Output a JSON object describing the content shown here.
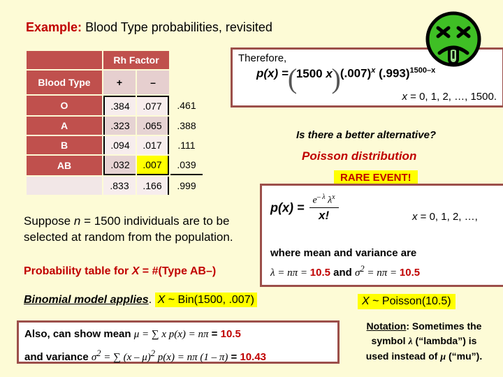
{
  "slide": {
    "background_color": "#fdfbd6",
    "accent_red": "#c00000",
    "table_red": "#c0504d",
    "box_border": "#9c4f4a",
    "highlight_yellow": "#ffff00"
  },
  "title": {
    "keyword": "Example:",
    "rest": "Blood Type probabilities, revisited"
  },
  "table": {
    "corner_blank": "",
    "group_header": "Rh Factor",
    "row_header_label": "Blood Type",
    "sub_headers": [
      "+",
      "–"
    ],
    "margin_header_blank": "",
    "rows": [
      {
        "label": "O",
        "plus": ".384",
        "minus": ".077",
        "total": ".461"
      },
      {
        "label": "A",
        "plus": ".323",
        "minus": ".065",
        "total": ".388"
      },
      {
        "label": "B",
        "plus": ".094",
        "minus": ".017",
        "total": ".111"
      },
      {
        "label": "AB",
        "plus": ".032",
        "minus": ".007",
        "total": ".039"
      }
    ],
    "footer": {
      "label": "",
      "plus": ".833",
      "minus": ".166",
      "total": ".999"
    },
    "highlighted_cell": ".007"
  },
  "suppose": {
    "line1_a": "Suppose",
    "line1_var": "n",
    "line1_b": "= 1500 individuals are to be selected at random from the population."
  },
  "prob_table_caption": {
    "a": "Probability table for ",
    "var": "X",
    "b": " = #(Type AB–)"
  },
  "binomial_line": {
    "applies": "Binomial model applies",
    "period": ".",
    "var": "X",
    "dist": " ~ Bin(1500, .007)"
  },
  "mean_variance_box": {
    "line1_a": "Also, can show mean ",
    "line1_mu": "μ",
    "line1_b": " = ∑ x p(x)  = ",
    "line1_npi": "nπ",
    "line1_eq": " =  ",
    "line1_val": "10.5",
    "line2_a": "and variance  ",
    "line2_sigma": "σ",
    "line2_sup": "2",
    "line2_b": " = ∑ (x – μ)",
    "line2_sup2": "2",
    "line2_c": " p(x) = ",
    "line2_npi": "nπ (1 – π)",
    "line2_eq": " =  ",
    "line2_val": "10.43"
  },
  "therefore_box": {
    "label": "Therefore,",
    "pmf_lhs": "p(x) =",
    "coef_top": "1500",
    "coef_bottom": "x",
    "term1": "(.007)",
    "term1_exp": "x",
    "term2": "(.993)",
    "term2_exp": "1500–x",
    "x_range_var": "x",
    "x_range": " = 0, 1, 2, …, 1500."
  },
  "sick_face_icon": "sick-green-face-icon",
  "alternative_question": "Is there a better alternative?",
  "poisson_header": "Poisson distribution",
  "rare_event_badge": "RARE EVENT!",
  "poisson_box": {
    "pmf_lhs": "p(x)  =",
    "numerator_e": "e",
    "numerator_e_exp": "– λ",
    "numerator_lambda": "λ",
    "numerator_lambda_exp": "x",
    "denominator": "x!",
    "x_range_var": "x",
    "x_range": " = 0, 1, 2, …,",
    "note": "where mean and variance are",
    "vals_lambda": "λ",
    "vals_a": " = nπ = ",
    "vals_1": "10.5",
    "vals_and": "  and  ",
    "vals_sigma": "σ",
    "vals_sigma_sup": "2",
    "vals_b": " = nπ = ",
    "vals_2": "10.5"
  },
  "poisson_model_line": {
    "var": "X",
    "dist": " ~ Poisson(10.5)"
  },
  "notation": {
    "heading": "Notation",
    "line1": ": Sometimes the",
    "line2_a": "symbol ",
    "line2_lambda": "λ",
    "line2_b": " (“lambda”) is",
    "line3_a": "used instead of ",
    "line3_mu": "μ",
    "line3_b": " (“mu”)."
  }
}
